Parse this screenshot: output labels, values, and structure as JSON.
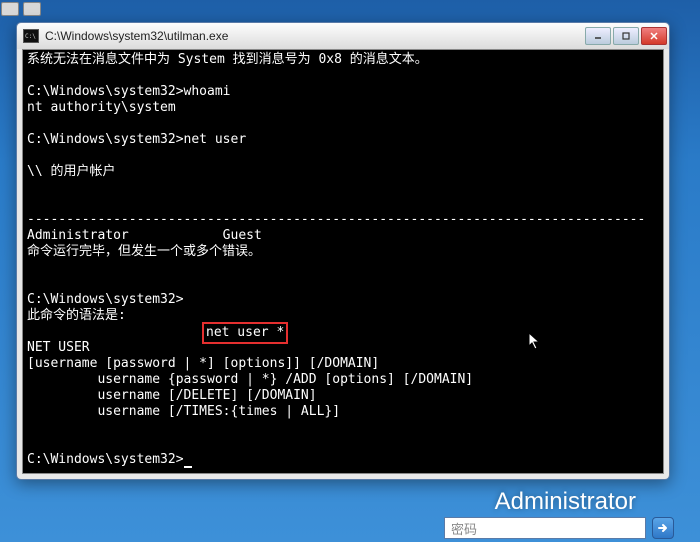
{
  "taskbar": {
    "item1": "",
    "item2": ""
  },
  "window": {
    "title": "C:\\Windows\\system32\\utilman.exe",
    "controls": {
      "min": "minimize",
      "max": "maximize",
      "close": "close"
    }
  },
  "console": {
    "line1": "系统无法在消息文件中为 System 找到消息号为 0x8 的消息文本。",
    "blank": "",
    "line2": "C:\\Windows\\system32>whoami",
    "line3": "nt authority\\system",
    "line4": "C:\\Windows\\system32>net user",
    "line5": "\\\\ 的用户帐户",
    "hr": "-------------------------------------------------------------------------------",
    "line6": "Administrator            Guest",
    "line7": "命令运行完毕，但发生一个或多个错误。",
    "prompt3": "C:\\Windows\\system32>",
    "cmd3": "net user *",
    "line8": "此命令的语法是:",
    "line9": "NET USER",
    "line10": "[username [password | *] [options]] [/DOMAIN]",
    "line11": "         username {password | *} /ADD [options] [/DOMAIN]",
    "line12": "         username [/DELETE] [/DOMAIN]",
    "line13": "         username [/TIMES:{times | ALL}]",
    "line14": "C:\\Windows\\system32>"
  },
  "login": {
    "username": "Administrator",
    "password_placeholder": "密码"
  }
}
